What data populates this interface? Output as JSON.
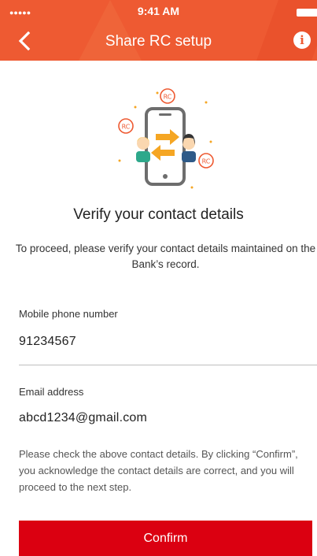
{
  "status_bar": {
    "signal": "●●●●●",
    "time": "9:41 AM"
  },
  "header": {
    "title": "Share RC setup",
    "back_icon": "chevron-left-icon",
    "info_icon": "info-icon",
    "info_glyph": "i"
  },
  "illustration": {
    "badge_text": "RC",
    "icon": "share-contact-illustration"
  },
  "heading": "Verify your contact details",
  "intro": "To proceed, please verify your contact details maintained on the Bank’s record.",
  "fields": {
    "mobile": {
      "label": "Mobile phone number",
      "value": "91234567"
    },
    "email": {
      "label": "Email address",
      "value": "abcd1234@gmail.com"
    }
  },
  "note": "Please check the above contact details. By clicking “Confirm”, you acknowledge the contact details are correct, and you will proceed to the next step.",
  "confirm_label": "Confirm",
  "colors": {
    "header": "#ee5a32",
    "button": "#db0011",
    "accent_orange": "#f5a623"
  }
}
